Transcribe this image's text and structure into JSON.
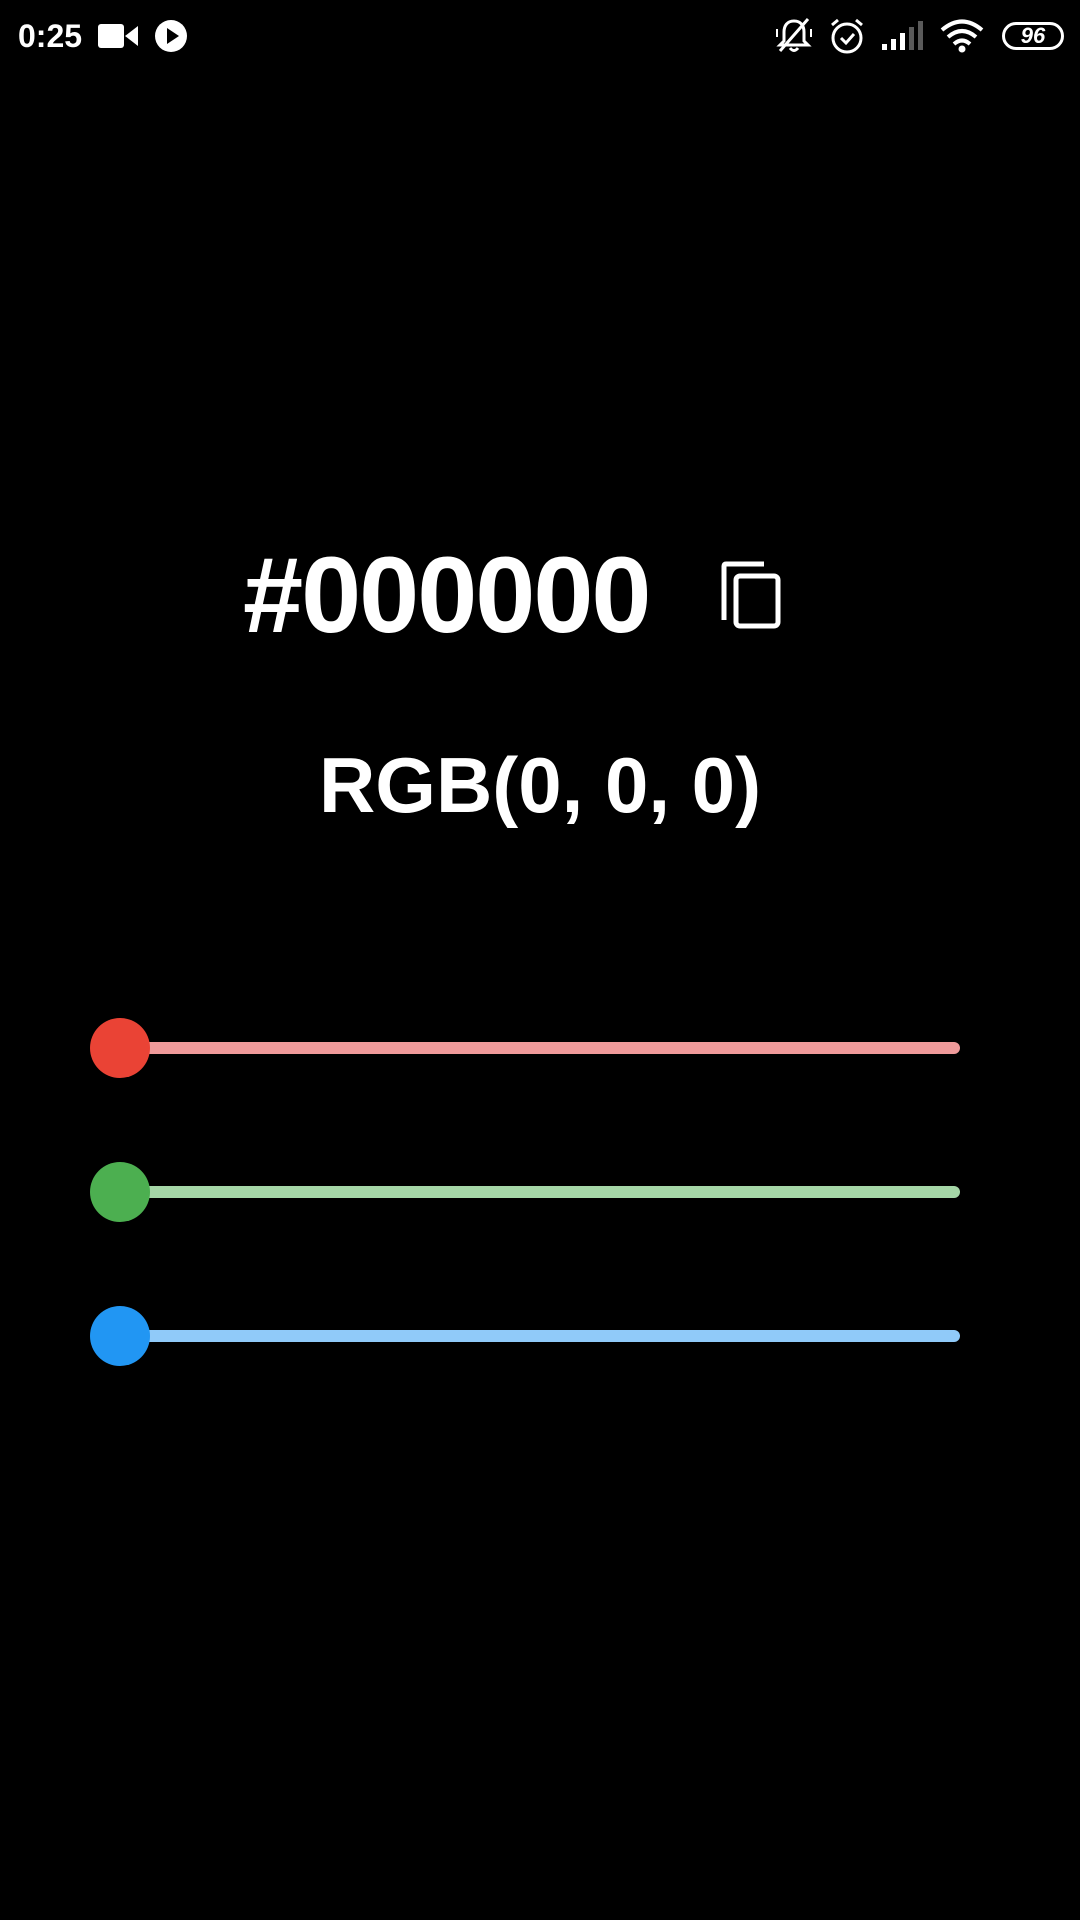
{
  "status_bar": {
    "time": "0:25",
    "left_icons": [
      "video-camera-icon",
      "play-circle-icon"
    ],
    "right_icons": [
      "bell-off-icon",
      "alarm-icon",
      "signal-icon",
      "wifi-icon"
    ],
    "battery_level": "96"
  },
  "color": {
    "hex": "#000000",
    "rgb": "RGB(0, 0, 0)",
    "copy_icon": "copy-icon"
  },
  "sliders": [
    {
      "name": "red",
      "value": 0,
      "max": 255,
      "thumb_color": "#ea4335",
      "track_color": "#ef9a9a"
    },
    {
      "name": "green",
      "value": 0,
      "max": 255,
      "thumb_color": "#4caf50",
      "track_color": "#a5d6a7"
    },
    {
      "name": "blue",
      "value": 0,
      "max": 255,
      "thumb_color": "#2196f3",
      "track_color": "#90caf9"
    }
  ]
}
